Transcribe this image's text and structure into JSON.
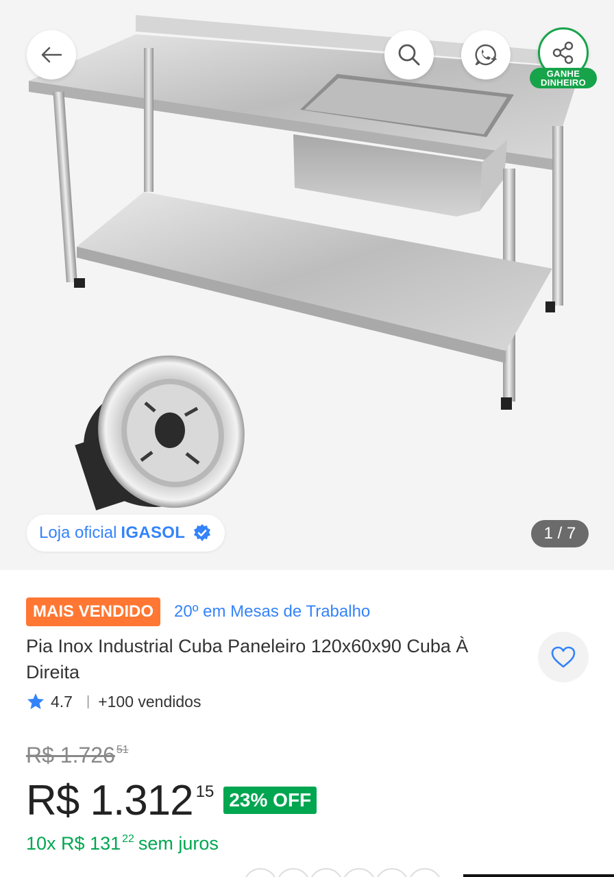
{
  "gallery": {
    "store_label": "Loja oficial",
    "store_name": "IGASOL",
    "image_counter": "1 / 7",
    "share_badge_line1": "GANHE",
    "share_badge_line2": "DINHEIRO"
  },
  "icons": {
    "back": "arrow-left-icon",
    "search": "search-icon",
    "whatsapp": "whatsapp-icon",
    "share": "share-icon",
    "verified": "verified-badge-icon",
    "favorite": "heart-icon",
    "rating": "star-icon"
  },
  "product": {
    "badge": "MAIS VENDIDO",
    "ranking": "20º em Mesas de Trabalho",
    "title": "Pia Inox Industrial Cuba Paneleiro 120x60x90 Cuba À Direita",
    "rating": "4.7",
    "sold": "+100 vendidos",
    "old_price": "R$ 1.726",
    "old_price_cents": "51",
    "price": "R$ 1.312",
    "price_cents": "15",
    "discount": "23% OFF",
    "installments_prefix": "10x R$ 131",
    "installments_cents": "22",
    "installments_suffix": "sem juros"
  },
  "colors": {
    "accent_blue": "#3483fa",
    "badge_orange": "#ff7733",
    "discount_green": "#00a650",
    "share_green": "#17a34a"
  }
}
